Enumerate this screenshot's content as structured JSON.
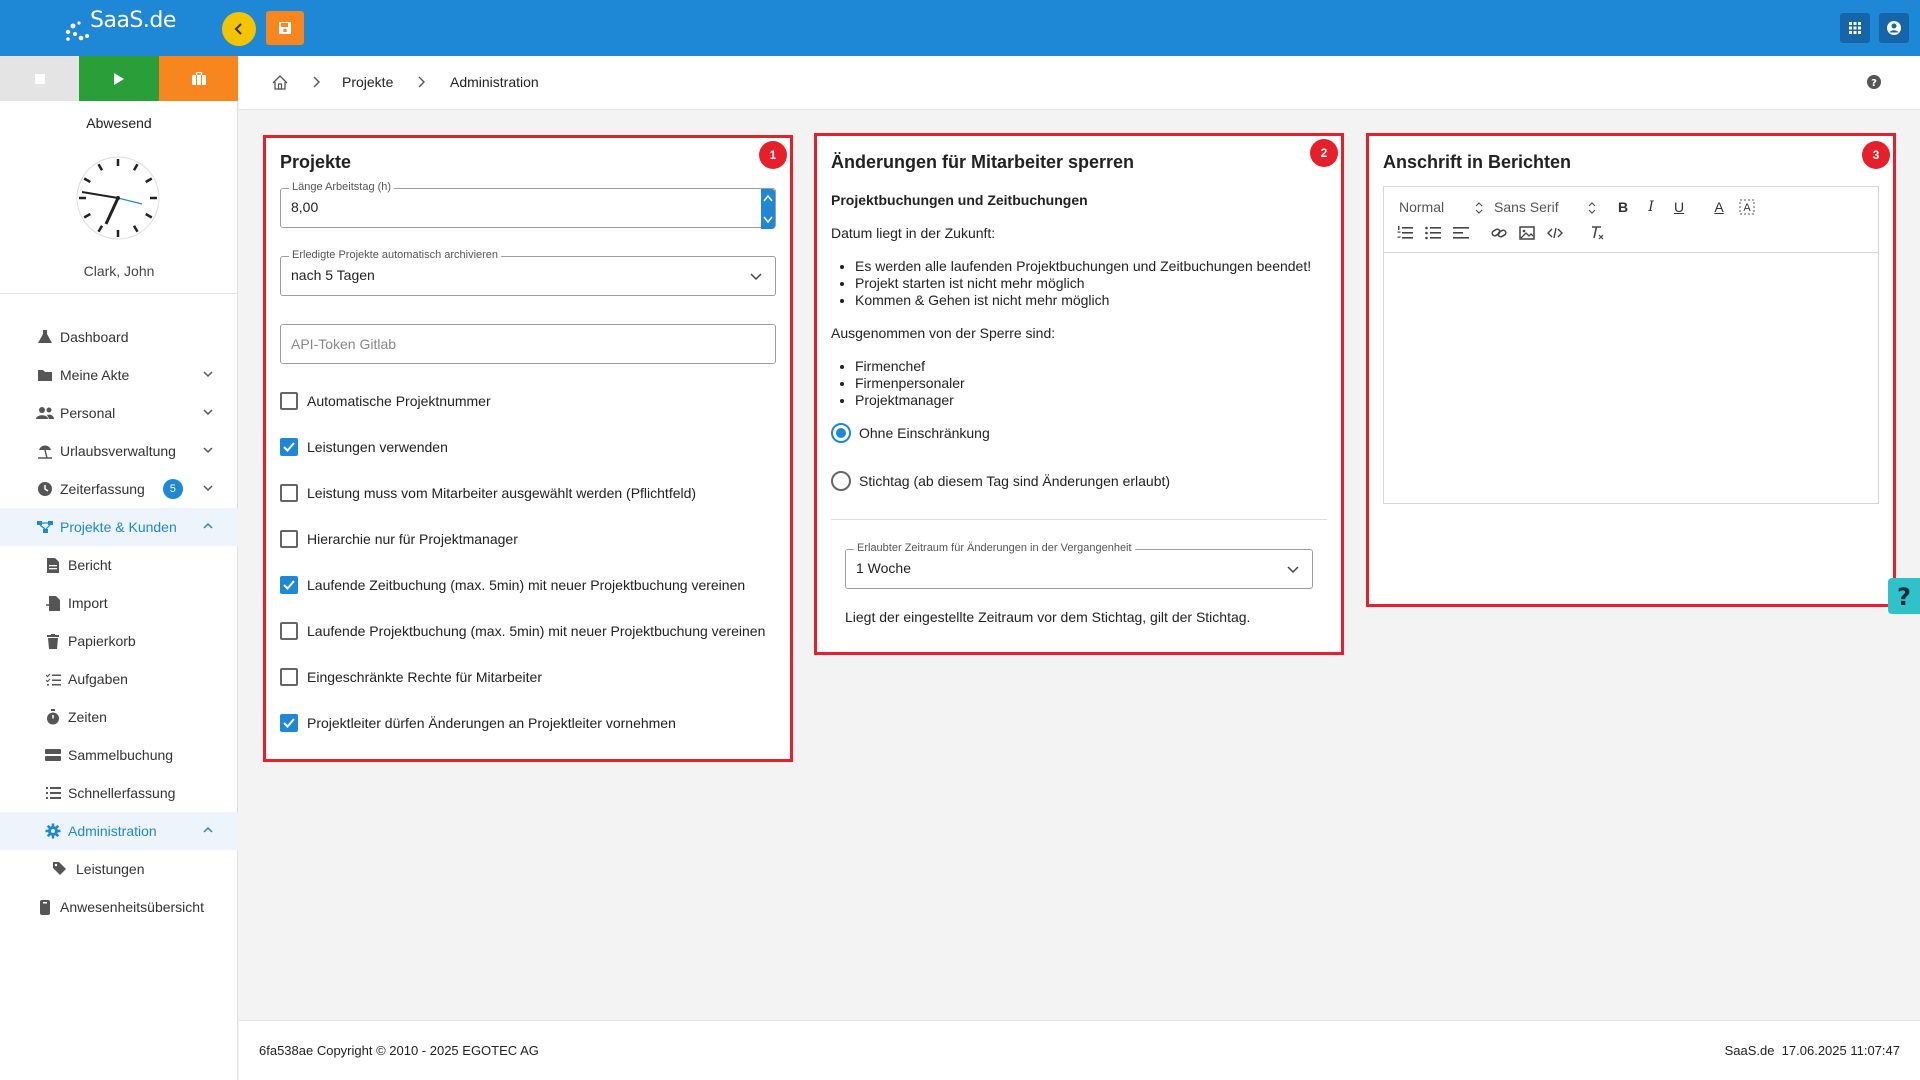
{
  "app": {
    "logo_text": "SaaS.de",
    "accent": "#1e88d6",
    "highlight": "#e5202a"
  },
  "topbar": {
    "back_icon": "chevron-left-icon",
    "save_icon": "floppy-disk-icon",
    "apps_icon": "grid-icon",
    "user_icon": "account-icon"
  },
  "sidebar": {
    "status": "Abwesend",
    "user_name": "Clark, John",
    "nav": [
      {
        "label": "Dashboard",
        "icon": "flask-icon"
      },
      {
        "label": "Meine Akte",
        "icon": "folder-icon"
      },
      {
        "label": "Personal",
        "icon": "people-icon"
      },
      {
        "label": "Urlaubsverwaltung",
        "icon": "beach-icon"
      },
      {
        "label": "Zeiterfassung",
        "icon": "clock-icon",
        "badge": "5"
      },
      {
        "label": "Projekte & Kunden",
        "icon": "hierarchy-icon"
      },
      {
        "label": "Bericht",
        "icon": "document-icon"
      },
      {
        "label": "Import",
        "icon": "file-import-icon"
      },
      {
        "label": "Papierkorb",
        "icon": "trash-icon"
      },
      {
        "label": "Aufgaben",
        "icon": "tasks-icon"
      },
      {
        "label": "Zeiten",
        "icon": "stopwatch-icon"
      },
      {
        "label": "Sammelbuchung",
        "icon": "stack-icon"
      },
      {
        "label": "Schnellerfassung",
        "icon": "list-icon"
      },
      {
        "label": "Administration",
        "icon": "gear-icon"
      },
      {
        "label": "Leistungen",
        "icon": "tags-icon"
      },
      {
        "label": "Anwesenheitsübersicht",
        "icon": "badge-icon"
      }
    ]
  },
  "breadcrumb": {
    "home_icon": "home-icon",
    "items": [
      "Projekte",
      "Administration"
    ]
  },
  "card1": {
    "badge": "1",
    "title": "Projekte",
    "workday_label": "Länge Arbeitstag (h)",
    "workday_value": "8,00",
    "archive_label": "Erledigte Projekte automatisch archivieren",
    "archive_value": "nach 5 Tagen",
    "token_placeholder": "API-Token Gitlab",
    "options": [
      {
        "label": "Automatische Projektnummer",
        "checked": false
      },
      {
        "label": "Leistungen verwenden",
        "checked": true
      },
      {
        "label": "Leistung muss vom Mitarbeiter ausgewählt werden (Pflichtfeld)",
        "checked": false
      },
      {
        "label": "Hierarchie nur für Projektmanager",
        "checked": false
      },
      {
        "label": "Laufende Zeitbuchung (max. 5min) mit neuer Projektbuchung vereinen",
        "checked": true
      },
      {
        "label": "Laufende Projektbuchung (max. 5min) mit neuer Projektbuchung vereinen",
        "checked": false
      },
      {
        "label": "Eingeschränkte Rechte für Mitarbeiter",
        "checked": false
      },
      {
        "label": "Projektleiter dürfen Änderungen an Projektleiter vornehmen",
        "checked": true
      }
    ]
  },
  "card2": {
    "badge": "2",
    "title": "Änderungen für Mitarbeiter sperren",
    "subtitle": "Projektbuchungen und Zeitbuchungen",
    "future_text": "Datum liegt in der Zukunft:",
    "future_items": [
      "Es werden alle laufenden Projektbuchungen und Zeitbuchungen beendet!",
      "Projekt starten ist nicht mehr möglich",
      "Kommen & Gehen ist nicht mehr möglich"
    ],
    "except_text": "Ausgenommen von der Sperre sind:",
    "except_items": [
      "Firmenchef",
      "Firmenpersonaler",
      "Projektmanager"
    ],
    "radio_none": "Ohne Einschränkung",
    "radio_cutoff": "Stichtag (ab diesem Tag sind Änderungen erlaubt)",
    "radio_selected": "none",
    "period_label": "Erlaubter Zeitraum für Änderungen in der Vergangenheit",
    "period_value": "1 Woche",
    "period_note": "Liegt der eingestellte Zeitraum vor dem Stichtag, gilt der Stichtag."
  },
  "card3": {
    "badge": "3",
    "title": "Anschrift in Berichten",
    "editor": {
      "paragraph": "Normal",
      "font": "Sans Serif"
    }
  },
  "footer": {
    "left": "6fa538ae Copyright © 2010 - 2025 EGOTEC AG",
    "brand": "SaaS.de",
    "timestamp": "17.06.2025 11:07:47"
  }
}
